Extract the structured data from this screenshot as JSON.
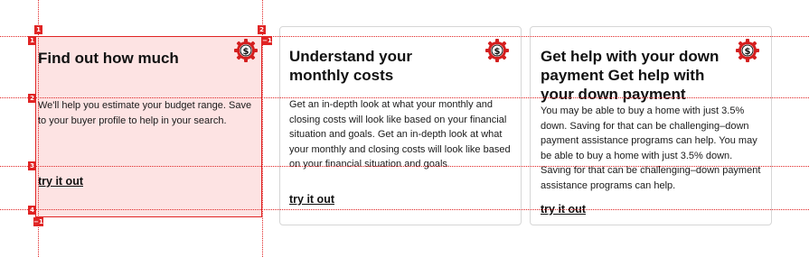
{
  "icon": "dollar-gear-icon",
  "accent_color": "#e02424",
  "selection_fill": "#fde3e3",
  "cards": [
    {
      "title": "Find out how much",
      "body": "We'll help you estimate your budget range. Save to your buyer profile to help in your search.",
      "link": "try it out"
    },
    {
      "title": "Understand your monthly costs",
      "body": "Get an in-depth look at what your monthly and closing costs will look like based on your financial situation and goals. Get an in-depth look at what your monthly and closing costs will look like based on your financial situation and goals.",
      "link": "try it out"
    },
    {
      "title": "Get help with your down payment Get help with your down payment",
      "body": "You may be able to buy a home with just 3.5% down. Saving for that can be challenging–down payment assistance programs can help. You may be able to buy a home with just 3.5% down. Saving for that can be challenging–down payment assistance programs can help.",
      "link": "try it out"
    }
  ],
  "markers": {
    "top_left": "1",
    "row_1": "1",
    "top_right": "2",
    "right_side": "−1",
    "row_2": "2",
    "row_3": "3",
    "row_4": "4",
    "bottom": "−1"
  }
}
